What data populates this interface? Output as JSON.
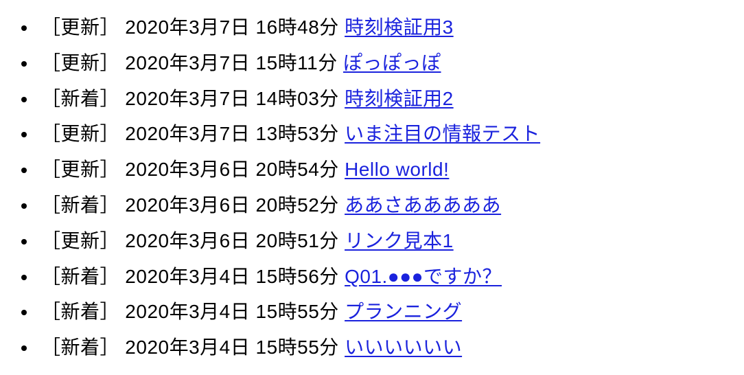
{
  "items": [
    {
      "tag": "［更新］",
      "date": "2020年3月7日 16時48分",
      "title": "時刻検証用3"
    },
    {
      "tag": "［更新］",
      "date": "2020年3月7日 15時11分",
      "title": "ぽっぽっぽ"
    },
    {
      "tag": "［新着］",
      "date": "2020年3月7日 14時03分",
      "title": "時刻検証用2"
    },
    {
      "tag": "［更新］",
      "date": "2020年3月7日 13時53分",
      "title": "いま注目の情報テスト"
    },
    {
      "tag": "［更新］",
      "date": "2020年3月6日 20時54分",
      "title": "Hello world!"
    },
    {
      "tag": "［新着］",
      "date": "2020年3月6日 20時52分",
      "title": "ああさあああああ"
    },
    {
      "tag": "［更新］",
      "date": "2020年3月6日 20時51分",
      "title": "リンク見本1"
    },
    {
      "tag": "［新着］",
      "date": "2020年3月4日 15時56分",
      "title": "Q01.●●●ですか？"
    },
    {
      "tag": "［新着］",
      "date": "2020年3月4日 15時55分",
      "title": "プランニング"
    },
    {
      "tag": "［新着］",
      "date": "2020年3月4日 15時55分",
      "title": "いいいいいい"
    }
  ]
}
